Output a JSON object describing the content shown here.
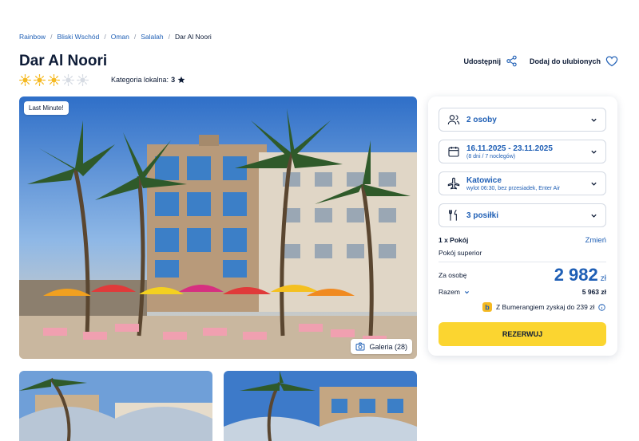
{
  "breadcrumb": [
    "Rainbow",
    "Bliski Wschód",
    "Oman",
    "Salalah",
    "Dar Al Noori"
  ],
  "hotel": {
    "name": "Dar Al Noori",
    "rating_suns": 3,
    "rating_max": 5,
    "category_label": "Kategoria lokalna:",
    "category_value": "3"
  },
  "actions": {
    "share": "Udostępnij",
    "favorite": "Dodaj do ulubionych"
  },
  "photo": {
    "badge": "Last Minute!",
    "gallery": "Galeria (28)"
  },
  "booking": {
    "persons": "2 osoby",
    "dates": "16.11.2025 - 23.11.2025",
    "dates_sub": "(8 dni / 7 noclegów)",
    "airport": "Katowice",
    "flight_sub": "wylot 06:30, bez przesiadek, Enter Air",
    "meals": "3 posiłki",
    "room_count": "1 x Pokój",
    "change": "Zmień",
    "room_type": "Pokój superior",
    "per_person_label": "Za osobę",
    "price": "2 982",
    "currency": "zł",
    "total_label": "Razem",
    "total": "5 963 zł",
    "bumerang": "Z Bumerangiem zyskaj do 239 zł",
    "reserve": "REZERWUJ"
  },
  "colors": {
    "accent": "#1f5fb5",
    "cta": "#fbd530",
    "sun_active": "#f5b921",
    "sun_inactive": "#d6dbe3"
  }
}
